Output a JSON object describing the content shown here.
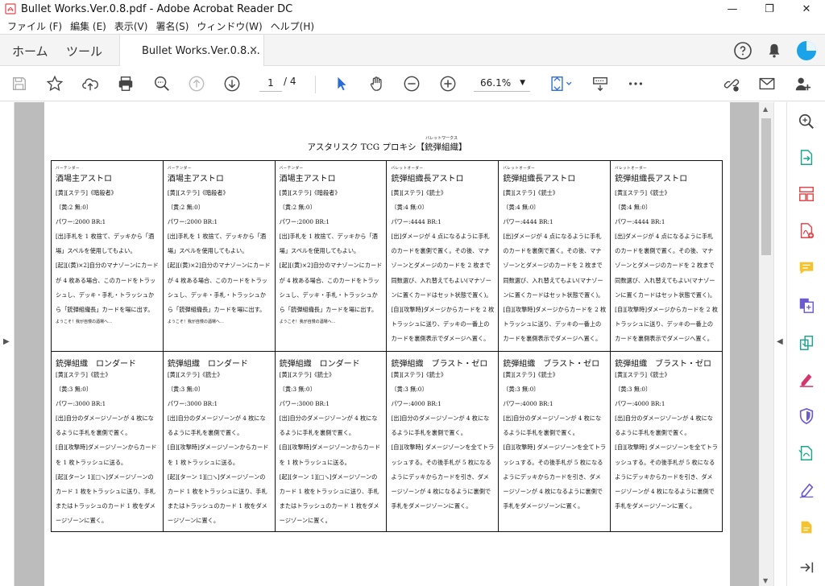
{
  "window": {
    "title": "Bullet Works.Ver.0.8.pdf - Adobe Acrobat Reader DC",
    "minimize": "—",
    "restore": "❐",
    "close": "✕"
  },
  "menu": [
    "ファイル (F)",
    "編集 (E)",
    "表示(V)",
    "署名(S)",
    "ウィンドウ(W)",
    "ヘルプ(H)"
  ],
  "tabs": {
    "home": "ホーム",
    "tools": "ツール",
    "document": "Bullet Works.Ver.0.8....",
    "close": "×"
  },
  "toolbar": {
    "current_page": "1",
    "total_pages": "/ 4",
    "zoom": "66.1%"
  },
  "document": {
    "title_pre": "アスタリスク TCG プロキシ【",
    "title_main": "銃弾組織",
    "title_ruby": "バレットワークス",
    "title_post": "】",
    "cards_row1": [
      {
        "name": "酒場主アストロ",
        "ruby": "バーテンダー",
        "type": "[黄][ステラ]《暗殺者》",
        "cost": "〔黄:2 無:0〕",
        "power": "パワー:2000 BR:1",
        "text1": "[出]手札を 1 枚捨て、デッキから「酒場」スペルを使用してもよい。",
        "text2": "[起][(黄)×2]自分のマナゾーンにカードが 4 枚ある場合、このカードをトラッシュし、デッキ・手札・トラッシュから「銃弾組織長」カードを場に出す。",
        "flavor": "ようこそ！我が自慢の酒場へ…"
      },
      {
        "name": "酒場主アストロ",
        "ruby": "バーテンダー",
        "type": "[黄][ステラ]《暗殺者》",
        "cost": "〔黄:2 無:0〕",
        "power": "パワー:2000 BR:1",
        "text1": "[出]手札を 1 枚捨て、デッキから「酒場」スペルを使用してもよい。",
        "text2": "[起][(黄)×2]自分のマナゾーンにカードが 4 枚ある場合、このカードをトラッシュし、デッキ・手札・トラッシュから「銃弾組織長」カードを場に出す。",
        "flavor": "ようこそ！我が自慢の酒場へ…"
      },
      {
        "name": "酒場主アストロ",
        "ruby": "バーテンダー",
        "type": "[黄][ステラ]《暗殺者》",
        "cost": "〔黄:2 無:0〕",
        "power": "パワー:2000 BR:1",
        "text1": "[出]手札を 1 枚捨て、デッキから「酒場」スペルを使用してもよい。",
        "text2": "[起][(黄)×2]自分のマナゾーンにカードが 4 枚ある場合、このカードをトラッシュし、デッキ・手札・トラッシュから「銃弾組織長」カードを場に出す。",
        "flavor": "ようこそ！我が自慢の酒場へ…"
      },
      {
        "name": "銃弾組織長アストロ",
        "ruby": "バレットオーダー",
        "type": "[黄][ステラ]《銃士》",
        "cost": "〔黄:4 無:0〕",
        "power": "パワー:4444 BR:1",
        "text1": "[出]ダメージが 4 点になるように手札のカードを裏側で置く。その後、マナゾーンとダメージのカードを 2 枚まで同数選び、入れ替えてもよい(マナゾーンに置くカードはセット状態で置く)。",
        "text2": "[自][攻撃時]ダメージからカードを 2 枚トラッシュに送り、デッキの一番上のカードを裏側表示でダメージへ置く。",
        "flavor": ""
      },
      {
        "name": "銃弾組織長アストロ",
        "ruby": "バレットオーダー",
        "type": "[黄][ステラ]《銃士》",
        "cost": "〔黄:4 無:0〕",
        "power": "パワー:4444 BR:1",
        "text1": "[出]ダメージが 4 点になるように手札のカードを裏側で置く。その後、マナゾーンとダメージのカードを 2 枚まで同数選び、入れ替えてもよい(マナゾーンに置くカードはセット状態で置く)。",
        "text2": "[自][攻撃時]ダメージからカードを 2 枚トラッシュに送り、デッキの一番上のカードを裏側表示でダメージへ置く。",
        "flavor": ""
      },
      {
        "name": "銃弾組織長アストロ",
        "ruby": "バレットオーダー",
        "type": "[黄][ステラ]《銃士》",
        "cost": "〔黄:4 無:0〕",
        "power": "パワー:4444 BR:1",
        "text1": "[出]ダメージが 4 点になるように手札のカードを裏側で置く。その後、マナゾーンとダメージのカードを 2 枚まで同数選び、入れ替えてもよい(マナゾーンに置くカードはセット状態で置く)。",
        "text2": "[自][攻撃時]ダメージからカードを 2 枚トラッシュに送り、デッキの一番上のカードを裏側表示でダメージへ置く。",
        "flavor": ""
      }
    ],
    "cards_row2": [
      {
        "name": "銃弾組織　ロンダード",
        "type": "[黄][ステラ]《銃士》",
        "cost": "〔黄:3 無:0〕",
        "power": "パワー:3000 BR:1",
        "text1": "[出]自分のダメージゾーンが 4 枚になるように手札を裏側で置く。",
        "text2": "[自][攻撃時]ダメージゾーンからカードを 1 枚トラッシュに送る。",
        "text3": "[起][ターン 1][□↘]ダメージゾーンのカード 1 枚をトラッシュに送り、手札またはトラッシュのカード 1 枚をダメージゾーンに置く。"
      },
      {
        "name": "銃弾組織　ロンダード",
        "type": "[黄][ステラ]《銃士》",
        "cost": "〔黄:3 無:0〕",
        "power": "パワー:3000 BR:1",
        "text1": "[出]自分のダメージゾーンが 4 枚になるように手札を裏側で置く。",
        "text2": "[自][攻撃時]ダメージゾーンからカードを 1 枚トラッシュに送る。",
        "text3": "[起][ターン 1][□↘]ダメージゾーンのカード 1 枚をトラッシュに送り、手札またはトラッシュのカード 1 枚をダメージゾーンに置く。"
      },
      {
        "name": "銃弾組織　ロンダード",
        "type": "[黄][ステラ]《銃士》",
        "cost": "〔黄:3 無:0〕",
        "power": "パワー:3000 BR:1",
        "text1": "[出]自分のダメージゾーンが 4 枚になるように手札を裏側で置く。",
        "text2": "[自][攻撃時]ダメージゾーンからカードを 1 枚トラッシュに送る。",
        "text3": "[起][ターン 1][□↘]ダメージゾーンのカード 1 枚をトラッシュに送り、手札またはトラッシュのカード 1 枚をダメージゾーンに置く。"
      },
      {
        "name": "銃弾組織　ブラスト・ゼロ",
        "type": "[黄][ステラ]《銃士》",
        "cost": "〔黄:3 無:0〕",
        "power": "パワー:4000 BR:1",
        "text1": "[出]自分のダメージゾーンが 4 枚になるように手札を裏側で置く。",
        "text2": "[自][攻撃時] ダメージゾーンを全てトラッシュする。その後手札が 5 枚になるようにデッキからカードを引き、ダメージゾーンが 4 枚になるように裏側で手札をダメージゾーンに置く。",
        "text3": ""
      },
      {
        "name": "銃弾組織　ブラスト・ゼロ",
        "type": "[黄][ステラ]《銃士》",
        "cost": "〔黄:3 無:0〕",
        "power": "パワー:4000 BR:1",
        "text1": "[出]自分のダメージゾーンが 4 枚になるように手札を裏側で置く。",
        "text2": "[自][攻撃時] ダメージゾーンを全てトラッシュする。その後手札が 5 枚になるようにデッキからカードを引き、ダメージゾーンが 4 枚になるように裏側で手札をダメージゾーンに置く。",
        "text3": ""
      },
      {
        "name": "銃弾組織　ブラスト・ゼロ",
        "type": "[黄][ステラ]《銃士》",
        "cost": "〔黄:3 無:0〕",
        "power": "パワー:4000 BR:1",
        "text1": "[出]自分のダメージゾーンが 4 枚になるように手札を裏側で置く。",
        "text2": "[自][攻撃時] ダメージゾーンを全てトラッシュする。その後手札が 5 枚になるようにデッキからカードを引き、ダメージゾーンが 4 枚になるように裏側で手札をダメージゾーンに置く。",
        "text3": ""
      }
    ]
  },
  "icons": {
    "toolbar": [
      "save-icon",
      "bookmark-star-icon",
      "upload-cloud-icon",
      "print-icon",
      "zoom-search-icon",
      "page-up-icon",
      "page-down-icon",
      "select-cursor-icon",
      "hand-tool-icon",
      "zoom-out-icon",
      "zoom-in-icon",
      "fit-page-icon",
      "read-mode-icon",
      "more-icon",
      "share-link-icon",
      "email-icon",
      "add-user-icon"
    ],
    "right_pane": [
      "zoom-tool-icon",
      "export-pdf-icon",
      "organize-pages-icon",
      "create-pdf-icon",
      "comment-icon",
      "combine-files-icon",
      "compress-icon",
      "fill-sign-icon",
      "protect-icon",
      "send-track-icon",
      "edit-pdf-icon",
      "more-tools-icon",
      "collapse-pane-icon"
    ]
  },
  "colors": {
    "accent_blue": "#2b6bd6",
    "pdf_red": "#e0474c",
    "comment_yellow": "#f4c430",
    "purple": "#6b5bd3",
    "teal": "#1ba78c",
    "pink": "#d6336c",
    "avatar": "#1aa3e8"
  }
}
